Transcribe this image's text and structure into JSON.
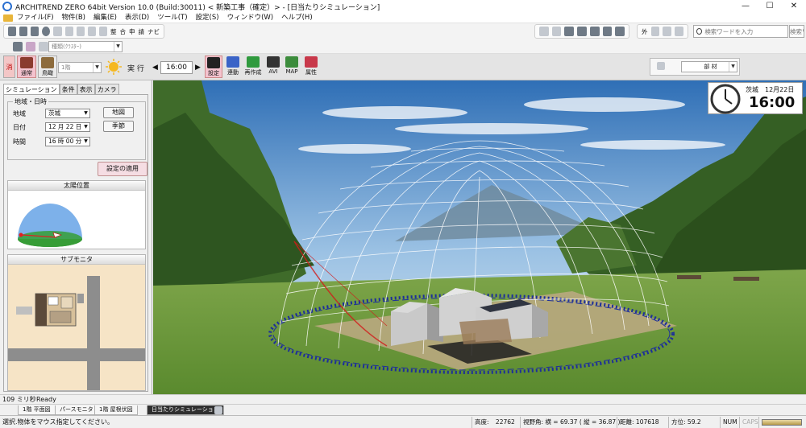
{
  "window": {
    "title": "ARCHITREND ZERO 64bit Version 10.0 (Build:30011) <            新築工事（確定）> - [日当たりシミュレーション]",
    "minimize": "—",
    "maximize": "☐",
    "close": "✕"
  },
  "menu": [
    "ファイル(F)",
    "物件(B)",
    "編集(E)",
    "表示(D)",
    "ツール(T)",
    "設定(S)",
    "ウィンドウ(W)",
    "ヘルプ(H)"
  ],
  "toolbar1": {
    "labels": [
      "整",
      "合",
      "申",
      "請",
      "ナビ"
    ],
    "ext_label": "外",
    "search1_placeholder": "検索ワードを入力",
    "search2_placeholder": "検索ワードを入力"
  },
  "toolbar2": {
    "view_combo": "種類(ｸﾗｽﾀｰ)"
  },
  "simbar": {
    "fire_label": "消",
    "normal_label": "通常",
    "birdseye_label": "鳥瞰",
    "floor_combo": "1階",
    "execute_label": "実 行",
    "time_value": "16:00",
    "prev_arrow": "◀",
    "next_arrow": "▶",
    "setting_label": "設定",
    "link_label": "連動",
    "replay_label": "再作成",
    "avi_label": "AVI",
    "map_label": "MAP",
    "attr_label": "属性",
    "material_label": "部 材"
  },
  "leftpanel": {
    "tabs": [
      "シミュレーション",
      "条件",
      "表示",
      "カメラ"
    ],
    "group_title": "地域・日時",
    "region_label": "地域",
    "region_value": "茨城",
    "date_label": "日付",
    "date_value": "12 月 22 日",
    "time_label": "時間",
    "time_value": "16 時 00 分",
    "map_button": "地図",
    "season_button": "季節",
    "apply_button": "設定の適用",
    "sun_position_title": "太陽位置",
    "sub_monitor_title": "サブモニタ"
  },
  "viewport": {
    "clock_region": "茨城",
    "clock_date": "12月22日",
    "clock_time": "16:00"
  },
  "status1": {
    "elapsed": "109 ミリ秒",
    "state": "Ready"
  },
  "doctabs": [
    "1階 平面図",
    "パースモニタ",
    "1階 屋根伏図",
    "日当たりシミュレーション"
  ],
  "status2": {
    "hint": "選択.物体をマウス指定してください。",
    "altitude_label": "高度:",
    "altitude_value": "22762",
    "fov_label": "視野角: 横 = 69.37 ( 縦 = 36.87 )",
    "distance_label": "距離:",
    "distance_value": "107618",
    "azimuth_label": "方位:",
    "azimuth_value": "59.2",
    "num": "NUM",
    "caps": "CAPS"
  },
  "colors": {
    "accent_pink": "#f4c3cf",
    "sky_top": "#2f6fb6",
    "grass": "#6e9a3e"
  }
}
